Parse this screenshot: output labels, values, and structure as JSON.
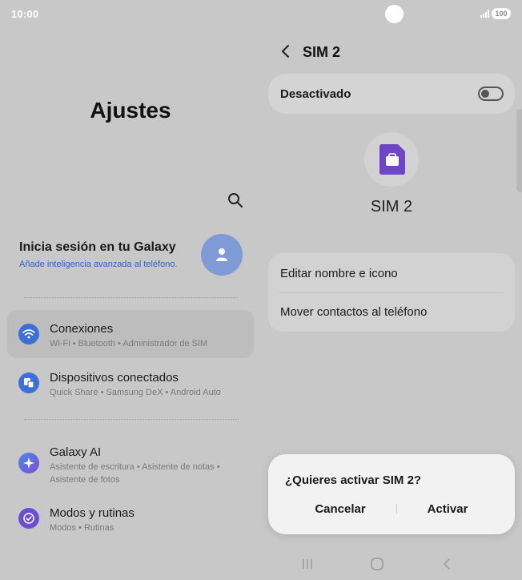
{
  "status_bar": {
    "time": "10:00",
    "battery": "100"
  },
  "settings": {
    "title": "Ajustes",
    "account": {
      "title": "Inicia sesión en tu Galaxy",
      "subtitle": "Añade inteligencia avanzada al teléfono."
    },
    "items": [
      {
        "title": "Conexiones",
        "subtitle": "Wi-Fi  •  Bluetooth  •  Administrador de SIM",
        "icon": "wifi-icon",
        "color": "#3d6fd8"
      },
      {
        "title": "Dispositivos conectados",
        "subtitle": "Quick Share  •  Samsung DeX  •  Android Auto",
        "icon": "devices-icon",
        "color": "#3d6fd8"
      },
      {
        "title": "Galaxy AI",
        "subtitle": "Asistente de escritura  •  Asistente de notas  •  Asistente de fotos",
        "icon": "sparkle-icon",
        "color": "#3a7be0"
      },
      {
        "title": "Modos y rutinas",
        "subtitle": "Modos  •  Rutinas",
        "icon": "check-circle-icon",
        "color": "#6a4fd0"
      }
    ]
  },
  "sim_screen": {
    "title": "SIM 2",
    "toggle_label": "Desactivado",
    "toggle_on": false,
    "sim_name": "SIM 2",
    "sim_color": "#6e45c4",
    "options": [
      "Editar nombre e icono",
      "Mover contactos al teléfono"
    ]
  },
  "dialog": {
    "message": "¿Quieres activar SIM 2?",
    "cancel": "Cancelar",
    "confirm": "Activar"
  },
  "nav": {
    "icons": [
      "recents-icon",
      "home-icon",
      "back-icon"
    ]
  }
}
